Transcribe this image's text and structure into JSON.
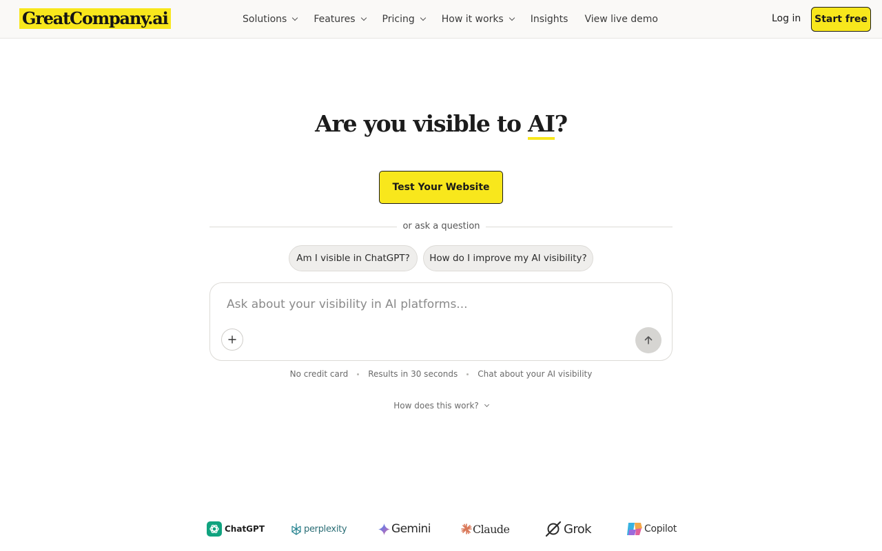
{
  "header": {
    "logo": "GreatCompany.ai",
    "nav": [
      {
        "label": "Solutions",
        "dropdown": true
      },
      {
        "label": "Features",
        "dropdown": true
      },
      {
        "label": "Pricing",
        "dropdown": true
      },
      {
        "label": "How it works",
        "dropdown": true
      },
      {
        "label": "Insights",
        "dropdown": false
      },
      {
        "label": "View live demo",
        "dropdown": false
      }
    ],
    "login_label": "Log in",
    "start_label": "Start free"
  },
  "hero": {
    "title_prefix": "Are you visible to ",
    "title_highlight": "AI",
    "title_suffix": "?",
    "cta_label": "Test Your Website",
    "divider_text": "or ask a question",
    "suggestions": [
      "Am I visible in ChatGPT?",
      "How do I improve my AI visibility?"
    ],
    "input_placeholder": "Ask about your visibility in AI platforms...",
    "input_value": "",
    "features": [
      "No credit card",
      "Results in 30 seconds",
      "Chat about your AI visibility"
    ],
    "how_link": "How does this work?"
  },
  "platforms": [
    {
      "name": "ChatGPT",
      "icon": "chatgpt-icon"
    },
    {
      "name": "perplexity",
      "icon": "perplexity-icon"
    },
    {
      "name": "Gemini",
      "icon": "gemini-icon"
    },
    {
      "name": "Claude",
      "icon": "claude-icon"
    },
    {
      "name": "Grok",
      "icon": "grok-icon"
    },
    {
      "name": "Copilot",
      "icon": "copilot-icon"
    }
  ],
  "colors": {
    "accent": "#f8e71c",
    "text": "#1c1c1c",
    "muted": "#6b6b6b",
    "header_bg": "#faf9f7",
    "chatgpt": "#10a37f",
    "perplexity": "#20808d",
    "gemini": "#4285f4",
    "claude": "#d97757"
  }
}
